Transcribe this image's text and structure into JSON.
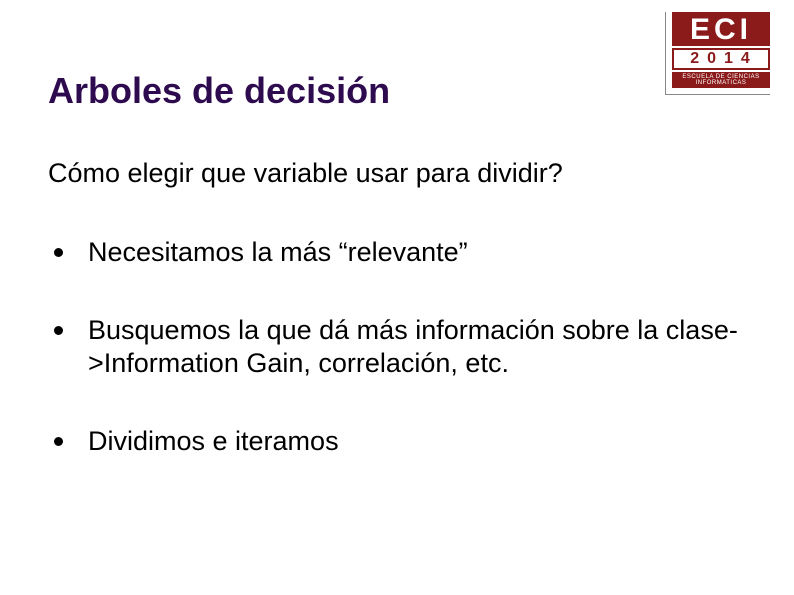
{
  "logo": {
    "name": "ECI",
    "year": "2014",
    "subtitle": "ESCUELA DE CIENCIAS INFORMATICAS"
  },
  "title": "Arboles de decisión",
  "subtitle": "Cómo elegir que variable usar para dividir?",
  "bullets": [
    "Necesitamos la más “relevante”",
    "Busquemos la que dá más información sobre la clase->Information Gain, correlación, etc.",
    "Dividimos e iteramos"
  ]
}
